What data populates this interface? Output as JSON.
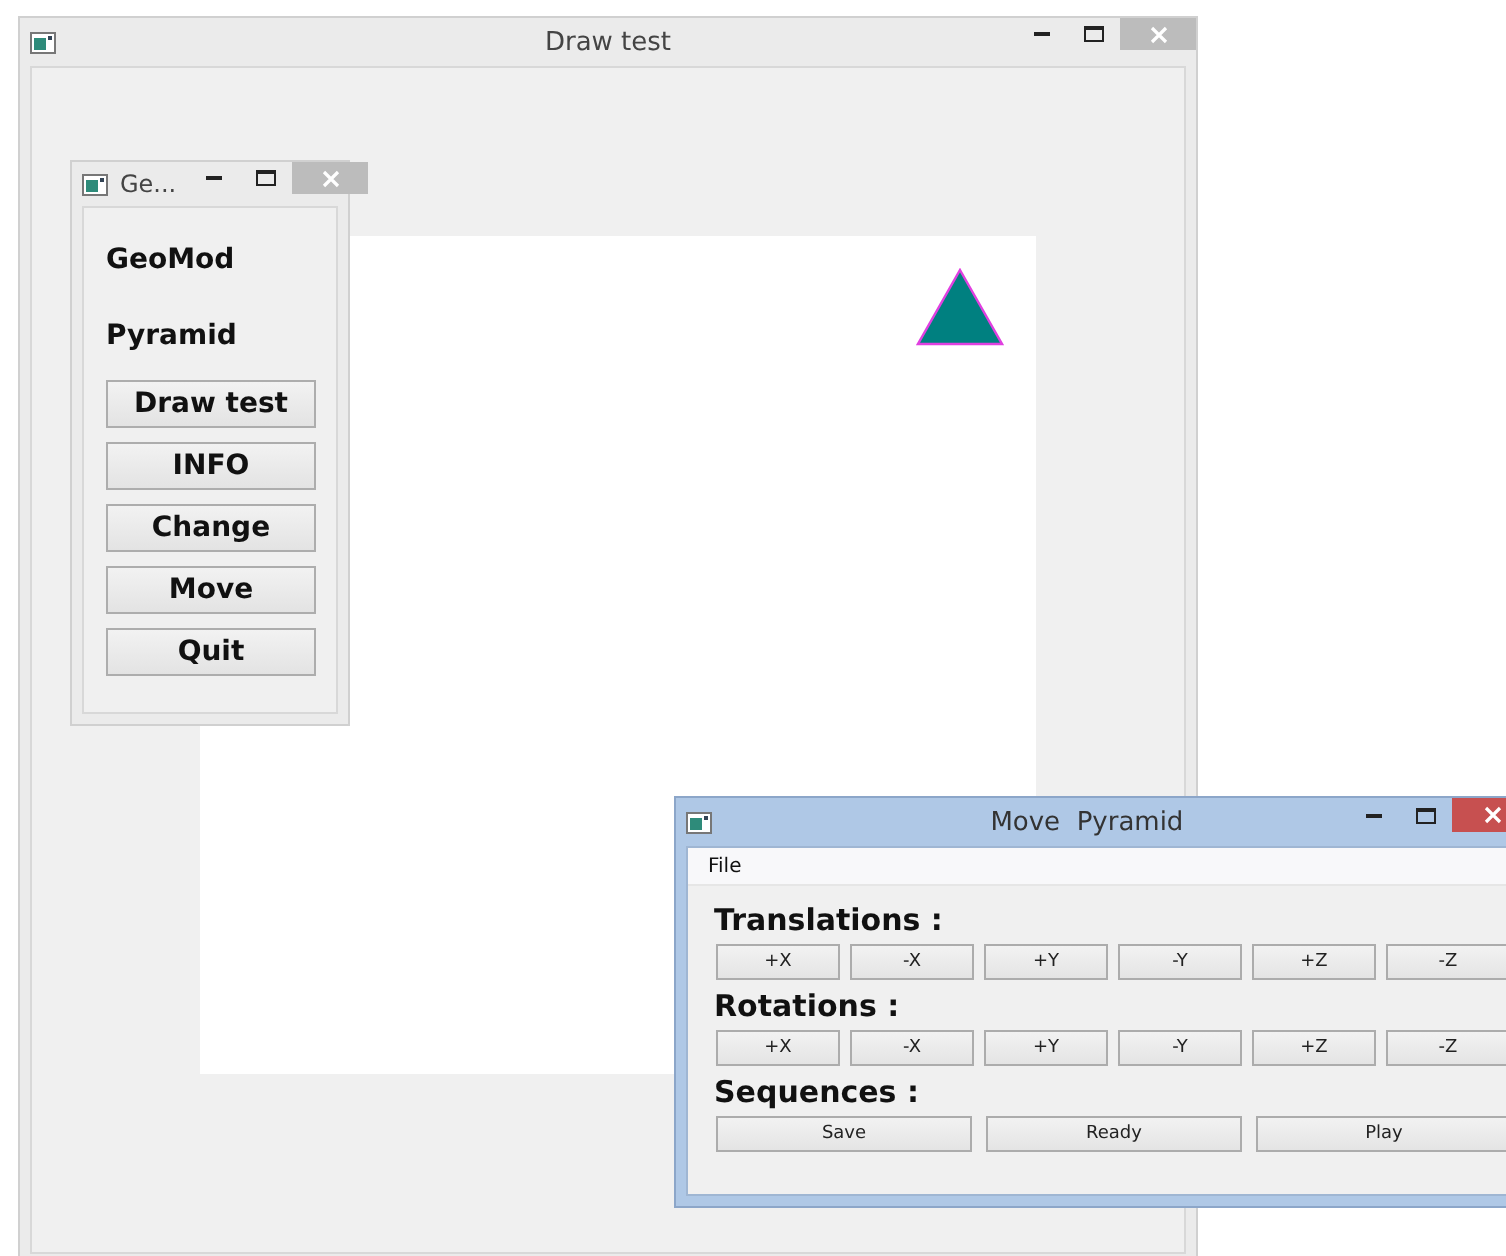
{
  "main_window": {
    "title": "Draw test",
    "active": false
  },
  "geomod_window": {
    "title": "Ge...",
    "active": false,
    "labels": [
      "GeoMod",
      "Pyramid"
    ],
    "buttons": [
      "Draw test",
      "INFO",
      "Change",
      "Move",
      "Quit"
    ]
  },
  "move_window": {
    "title": "Move  Pyramid",
    "active": true,
    "menu": [
      "File"
    ],
    "sections": [
      {
        "heading": "Translations :",
        "kind": "axes",
        "buttons": [
          "+X",
          "-X",
          "+Y",
          "-Y",
          "+Z",
          "-Z"
        ]
      },
      {
        "heading": "Rotations :",
        "kind": "axes",
        "buttons": [
          "+X",
          "-X",
          "+Y",
          "-Y",
          "+Z",
          "-Z"
        ]
      },
      {
        "heading": "Sequences :",
        "kind": "actions",
        "buttons": [
          "Save",
          "Ready",
          "Play"
        ]
      }
    ]
  }
}
